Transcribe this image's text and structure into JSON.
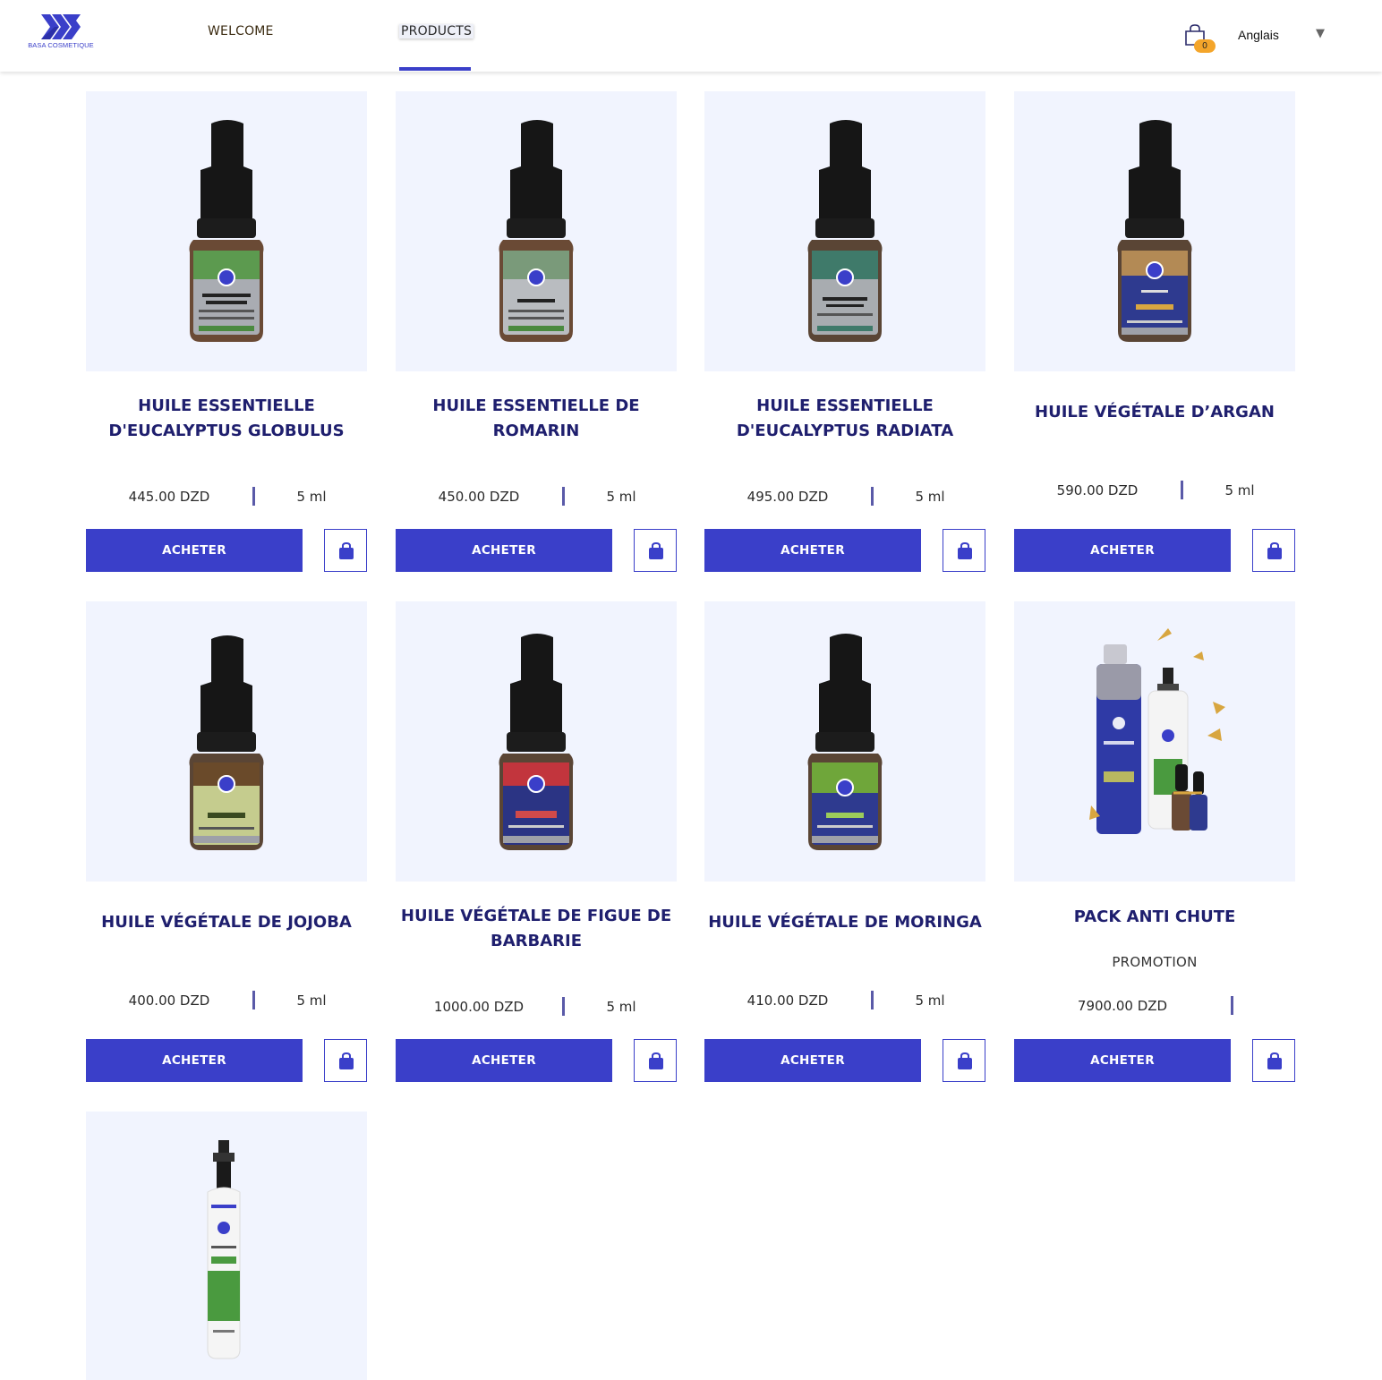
{
  "brand": {
    "logo_text": "BASA COSMETIQUE",
    "accent": "#3a3fc9",
    "title_color": "#1f1f6e",
    "card_bg": "#f1f4fe"
  },
  "nav": {
    "welcome": "WELCOME",
    "products": "PRODUCTS",
    "active": "PRODUCTS"
  },
  "cart": {
    "icon": "shopping-bag-icon",
    "count": "0"
  },
  "language": {
    "selected": "Anglais",
    "arrow": "▼"
  },
  "products": [
    {
      "title": "HUILE ESSENTIELLE D'EUCALYPTUS GLOBULUS",
      "price": "445.00 DZD",
      "volume": "5 ml",
      "buy": "ACHETER",
      "image": "dropper-bottle-eucalyptus-globulus"
    },
    {
      "title": "HUILE ESSENTIELLE DE ROMARIN",
      "price": "450.00 DZD",
      "volume": "5 ml",
      "buy": "ACHETER",
      "image": "dropper-bottle-romarin"
    },
    {
      "title": "HUILE ESSENTIELLE D'EUCALYPTUS RADIATA",
      "price": "495.00 DZD",
      "volume": "5 ml",
      "buy": "ACHETER",
      "image": "dropper-bottle-eucalyptus-radiata"
    },
    {
      "title": "HUILE VÉGÉTALE D’ARGAN",
      "price": "590.00 DZD",
      "volume": "5 ml",
      "buy": "ACHETER",
      "image": "dropper-bottle-argan"
    },
    {
      "title": "HUILE VÉGÉTALE DE JOJOBA",
      "price": "400.00 DZD",
      "volume": "5 ml",
      "buy": "ACHETER",
      "image": "dropper-bottle-jojoba"
    },
    {
      "title": "HUILE VÉGÉTALE DE FIGUE DE BARBARIE",
      "price": "1000.00 DZD",
      "volume": "5 ml",
      "buy": "ACHETER",
      "image": "dropper-bottle-figue-de-barbarie"
    },
    {
      "title": "HUILE VÉGÉTALE DE MORINGA",
      "price": "410.00 DZD",
      "volume": "5 ml",
      "buy": "ACHETER",
      "image": "dropper-bottle-moringa"
    },
    {
      "title": "PACK ANTI CHUTE",
      "promo": "PROMOTION",
      "price": "7900.00 DZD",
      "volume": "",
      "buy": "ACHETER",
      "image": "serum-pack-anti-chute"
    },
    {
      "title": "",
      "price": "",
      "volume": "",
      "buy": "",
      "image": "spray-bottle-hydrolat-menthe"
    }
  ]
}
